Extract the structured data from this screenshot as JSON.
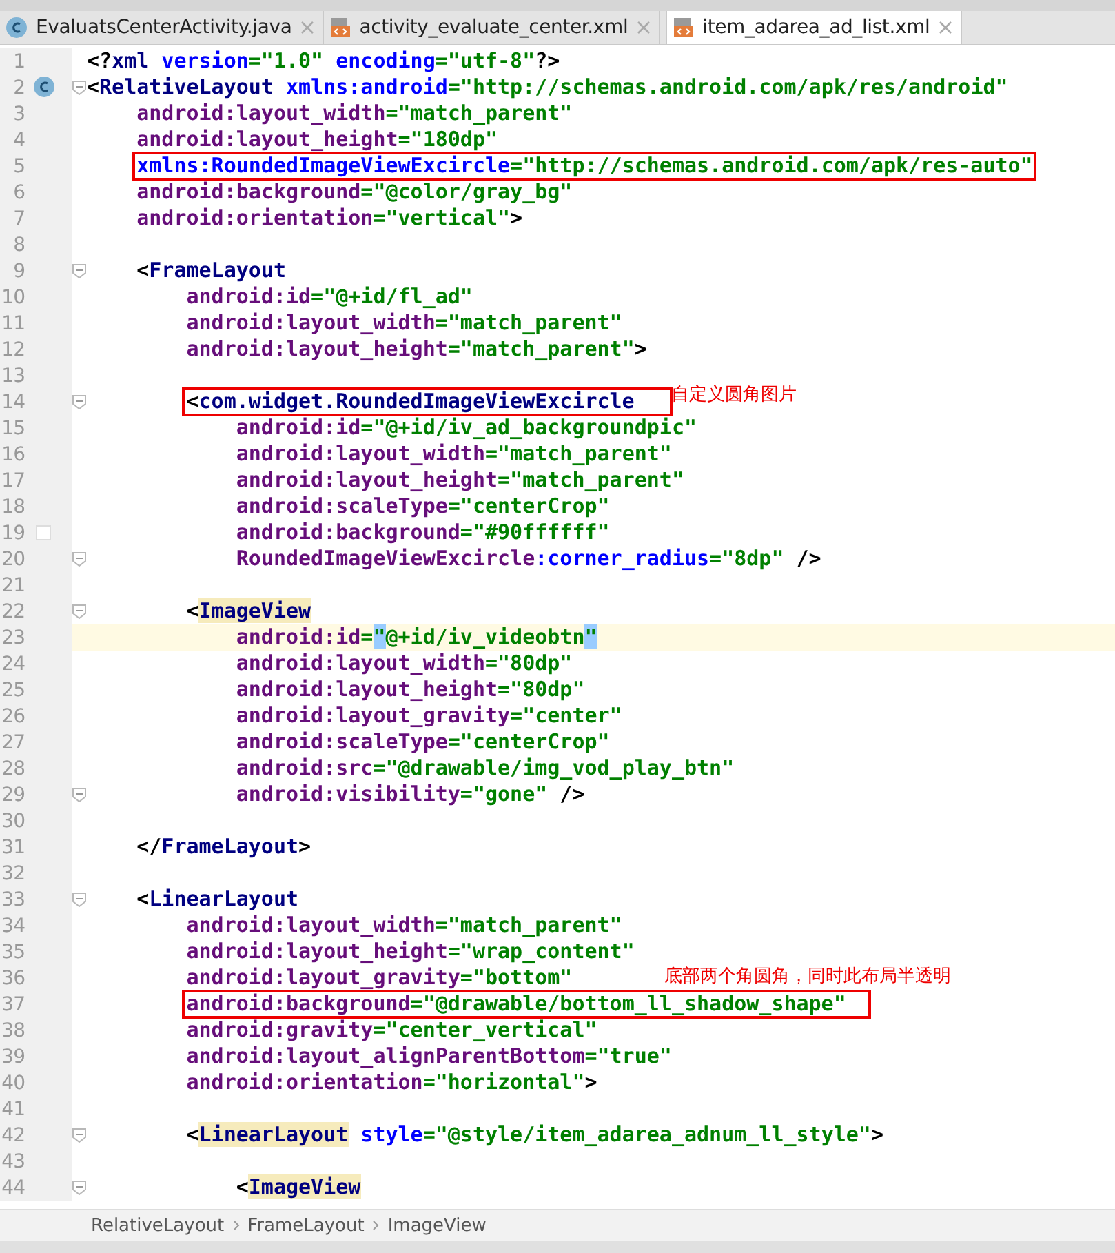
{
  "tabs": [
    {
      "label": "EvaluatsCenterActivity.java",
      "kind": "java",
      "selected": false
    },
    {
      "label": "activity_evaluate_center.xml",
      "kind": "xml",
      "selected": false
    },
    {
      "label": "item_adarea_ad_list.xml",
      "kind": "xml",
      "selected": true
    }
  ],
  "editor": {
    "lines": [
      {
        "number": "1",
        "tokens": [
          {
            "kind": "punct",
            "text": "<?"
          },
          {
            "kind": "tag",
            "text": "xml"
          },
          {
            "kind": "ns",
            "text": " version"
          },
          {
            "kind": "value",
            "text": "=\"1.0\""
          },
          {
            "kind": "ns",
            "text": " encoding"
          },
          {
            "kind": "value",
            "text": "=\"utf-8\""
          },
          {
            "kind": "punct",
            "text": "?>"
          }
        ]
      },
      {
        "number": "2",
        "fold": true,
        "class_marker": true,
        "tokens": [
          {
            "kind": "punct",
            "text": "<"
          },
          {
            "kind": "tag",
            "text": "RelativeLayout"
          },
          {
            "kind": "ns",
            "text": " xmlns:android"
          },
          {
            "kind": "value",
            "text": "=\"http://schemas.android.com/apk/res/android\""
          }
        ]
      },
      {
        "number": "3",
        "tokens": [
          {
            "kind": "attr",
            "text": "    android:layout_width"
          },
          {
            "kind": "value",
            "text": "=\"match_parent\""
          }
        ]
      },
      {
        "number": "4",
        "tokens": [
          {
            "kind": "attr",
            "text": "    android:layout_height"
          },
          {
            "kind": "value",
            "text": "=\"180dp\""
          }
        ]
      },
      {
        "number": "5",
        "boxed": true,
        "tokens": [
          {
            "kind": "ns",
            "text": "    xmlns:RoundedImageViewExcircle"
          },
          {
            "kind": "value",
            "text": "=\"http://schemas.android.com/apk/res-auto\""
          }
        ]
      },
      {
        "number": "6",
        "tokens": [
          {
            "kind": "attr",
            "text": "    android:background"
          },
          {
            "kind": "value",
            "text": "=\"@color/gray_bg\""
          }
        ]
      },
      {
        "number": "7",
        "tokens": [
          {
            "kind": "attr",
            "text": "    android:orientation"
          },
          {
            "kind": "value",
            "text": "=\"vertical\""
          },
          {
            "kind": "punct",
            "text": ">"
          }
        ]
      },
      {
        "number": "8"
      },
      {
        "number": "9",
        "fold": true,
        "tokens": [
          {
            "kind": "punct",
            "text": "    <"
          },
          {
            "kind": "tag",
            "text": "FrameLayout"
          }
        ]
      },
      {
        "number": "10",
        "tokens": [
          {
            "kind": "attr",
            "text": "        android:id"
          },
          {
            "kind": "value",
            "text": "=\"@+id/fl_ad\""
          }
        ]
      },
      {
        "number": "11",
        "tokens": [
          {
            "kind": "attr",
            "text": "        android:layout_width"
          },
          {
            "kind": "value",
            "text": "=\"match_parent\""
          }
        ]
      },
      {
        "number": "12",
        "tokens": [
          {
            "kind": "attr",
            "text": "        android:layout_height"
          },
          {
            "kind": "value",
            "text": "=\"match_parent\""
          },
          {
            "kind": "punct",
            "text": ">"
          }
        ]
      },
      {
        "number": "13"
      },
      {
        "number": "14",
        "fold": true,
        "boxed": true,
        "note": "自定义圆角图片",
        "tokens": [
          {
            "kind": "punct",
            "text": "        <"
          },
          {
            "kind": "tag",
            "text": "com.widget.RoundedImageViewExcircle"
          }
        ]
      },
      {
        "number": "15",
        "tokens": [
          {
            "kind": "attr",
            "text": "            android:id"
          },
          {
            "kind": "value",
            "text": "=\"@+id/iv_ad_backgroundpic\""
          }
        ]
      },
      {
        "number": "16",
        "tokens": [
          {
            "kind": "attr",
            "text": "            android:layout_width"
          },
          {
            "kind": "value",
            "text": "=\"match_parent\""
          }
        ]
      },
      {
        "number": "17",
        "tokens": [
          {
            "kind": "attr",
            "text": "            android:layout_height"
          },
          {
            "kind": "value",
            "text": "=\"match_parent\""
          }
        ]
      },
      {
        "number": "18",
        "tokens": [
          {
            "kind": "attr",
            "text": "            android:scaleType"
          },
          {
            "kind": "value",
            "text": "=\"centerCrop\""
          }
        ]
      },
      {
        "number": "19",
        "color_swatch": true,
        "tokens": [
          {
            "kind": "attr",
            "text": "            android:background"
          },
          {
            "kind": "value",
            "text": "=\"#90ffffff\""
          }
        ]
      },
      {
        "number": "20",
        "fold": true,
        "tokens": [
          {
            "kind": "attr",
            "text": "            RoundedImageViewExcircle"
          },
          {
            "kind": "ns",
            "text": ":corner_radius"
          },
          {
            "kind": "value",
            "text": "=\"8dp\""
          },
          {
            "kind": "punct",
            "text": " />"
          }
        ]
      },
      {
        "number": "21"
      },
      {
        "number": "22",
        "fold": true,
        "tokens": [
          {
            "kind": "punct",
            "text": "        <"
          },
          {
            "kind": "tag",
            "text": "ImageView",
            "matched": true
          }
        ]
      },
      {
        "number": "23",
        "current": true,
        "tokens": [
          {
            "kind": "attr",
            "text": "            android:id"
          },
          {
            "kind": "value",
            "text": "="
          },
          {
            "kind": "value",
            "text": "\"",
            "matched": true
          },
          {
            "kind": "value",
            "text": "@+id/iv_videobtn"
          },
          {
            "kind": "value",
            "text": "\"",
            "matched": true
          }
        ]
      },
      {
        "number": "24",
        "tokens": [
          {
            "kind": "attr",
            "text": "            android:layout_width"
          },
          {
            "kind": "value",
            "text": "=\"80dp\""
          }
        ]
      },
      {
        "number": "25",
        "tokens": [
          {
            "kind": "attr",
            "text": "            android:layout_height"
          },
          {
            "kind": "value",
            "text": "=\"80dp\""
          }
        ]
      },
      {
        "number": "26",
        "tokens": [
          {
            "kind": "attr",
            "text": "            android:layout_gravity"
          },
          {
            "kind": "value",
            "text": "=\"center\""
          }
        ]
      },
      {
        "number": "27",
        "tokens": [
          {
            "kind": "attr",
            "text": "            android:scaleType"
          },
          {
            "kind": "value",
            "text": "=\"centerCrop\""
          }
        ]
      },
      {
        "number": "28",
        "tokens": [
          {
            "kind": "attr",
            "text": "            android:src"
          },
          {
            "kind": "value",
            "text": "=\"@drawable/img_vod_play_btn\""
          }
        ]
      },
      {
        "number": "29",
        "fold": true,
        "tokens": [
          {
            "kind": "attr",
            "text": "            android:visibility"
          },
          {
            "kind": "value",
            "text": "=\"gone\""
          },
          {
            "kind": "punct",
            "text": " />"
          }
        ]
      },
      {
        "number": "30"
      },
      {
        "number": "31",
        "tokens": [
          {
            "kind": "punct",
            "text": "    </"
          },
          {
            "kind": "tag",
            "text": "FrameLayout"
          },
          {
            "kind": "punct",
            "text": ">"
          }
        ]
      },
      {
        "number": "32"
      },
      {
        "number": "33",
        "fold": true,
        "tokens": [
          {
            "kind": "punct",
            "text": "    <"
          },
          {
            "kind": "tag",
            "text": "LinearLayout"
          }
        ]
      },
      {
        "number": "34",
        "tokens": [
          {
            "kind": "attr",
            "text": "        android:layout_width"
          },
          {
            "kind": "value",
            "text": "=\"match_parent\""
          }
        ]
      },
      {
        "number": "35",
        "tokens": [
          {
            "kind": "attr",
            "text": "        android:layout_height"
          },
          {
            "kind": "value",
            "text": "=\"wrap_content\""
          }
        ]
      },
      {
        "number": "36",
        "note": "底部两个角圆角，同时此布局半透明",
        "tokens": [
          {
            "kind": "attr",
            "text": "        android:layout_gravity"
          },
          {
            "kind": "value",
            "text": "=\"bottom\""
          }
        ]
      },
      {
        "number": "37",
        "boxed": true,
        "tokens": [
          {
            "kind": "attr",
            "text": "        android:background"
          },
          {
            "kind": "value",
            "text": "=\"@drawable/bottom_ll_shadow_shape\""
          }
        ]
      },
      {
        "number": "38",
        "tokens": [
          {
            "kind": "attr",
            "text": "        android:gravity"
          },
          {
            "kind": "value",
            "text": "=\"center_vertical\""
          }
        ]
      },
      {
        "number": "39",
        "tokens": [
          {
            "kind": "attr",
            "text": "        android:layout_alignParentBottom"
          },
          {
            "kind": "value",
            "text": "=\"true\""
          }
        ]
      },
      {
        "number": "40",
        "tokens": [
          {
            "kind": "attr",
            "text": "        android:orientation"
          },
          {
            "kind": "value",
            "text": "=\"horizontal\""
          },
          {
            "kind": "punct",
            "text": ">"
          }
        ]
      },
      {
        "number": "41"
      },
      {
        "number": "42",
        "fold": true,
        "tokens": [
          {
            "kind": "punct",
            "text": "        <"
          },
          {
            "kind": "tag",
            "text": "LinearLayout",
            "matched": true
          },
          {
            "kind": "ns",
            "text": " style"
          },
          {
            "kind": "value",
            "text": "=\"@style/item_adarea_adnum_ll_style\""
          },
          {
            "kind": "punct",
            "text": ">"
          }
        ]
      },
      {
        "number": "43"
      },
      {
        "number": "44",
        "fold": true,
        "tokens": [
          {
            "kind": "punct",
            "text": "            <"
          },
          {
            "kind": "tag",
            "text": "ImageView",
            "matched": true
          }
        ]
      }
    ]
  },
  "breadcrumbs": [
    "RelativeLayout",
    "FrameLayout",
    "ImageView"
  ]
}
